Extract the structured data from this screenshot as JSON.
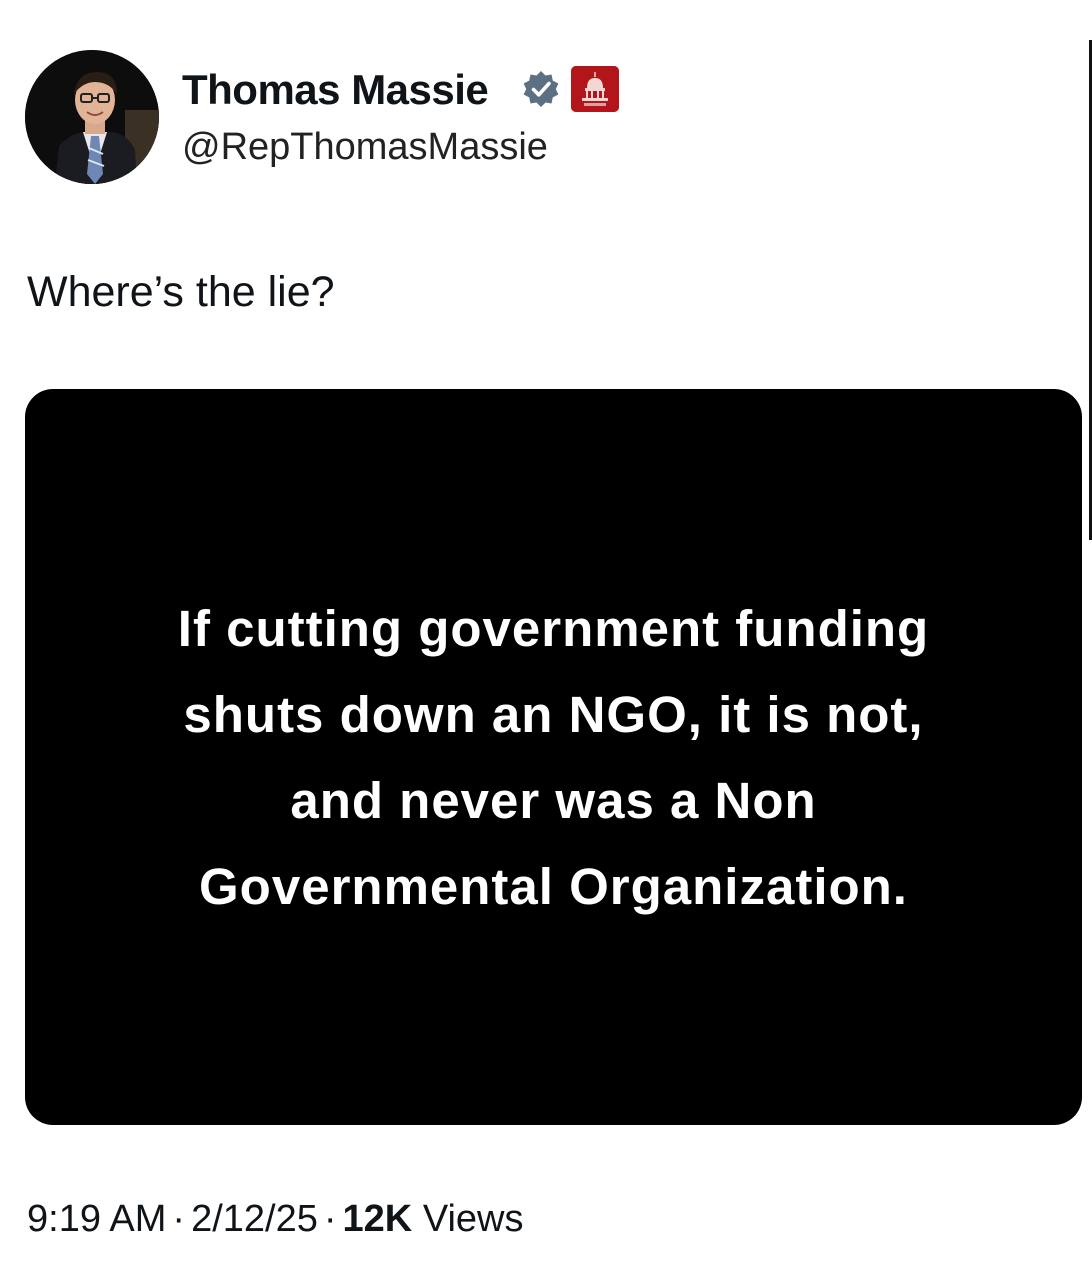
{
  "author": {
    "display_name": "Thomas Massie",
    "handle": "@RepThomasMassie",
    "avatar_icon": "profile-photo",
    "verified_icon": "verified-badge-icon",
    "affiliate_icon": "capitol-dome-icon",
    "colors": {
      "verified_badge": "#5b7083",
      "affiliate_badge": "#b2161b"
    }
  },
  "tweet": {
    "text": "Where’s the lie?",
    "media": {
      "background": "#000000",
      "text_color": "#ffffff",
      "lines": [
        "If cutting government funding",
        "shuts down an NGO, it is not,",
        "and never was a Non",
        "Governmental Organization."
      ]
    }
  },
  "meta": {
    "time": "9:19 AM",
    "separator": "·",
    "date": "2/12/25",
    "views_count": "12K",
    "views_label": "Views"
  }
}
